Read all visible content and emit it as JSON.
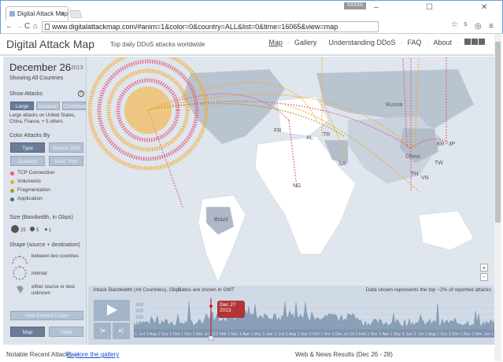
{
  "browser": {
    "tab_title": "Digital Attack Map",
    "user_badge": "XXXXX",
    "url": "www.digitalattackmap.com/#anim=1&color=0&country=ALL&list=0&time=16065&view=map"
  },
  "header": {
    "logo": "Digital Attack Map",
    "tagline": "Top daily DDoS attacks worldwide",
    "nav": [
      "Map",
      "Gallery",
      "Understanding DDoS",
      "FAQ",
      "About"
    ]
  },
  "sidebar": {
    "date": "December 26",
    "year": "2013",
    "showing": "Showing All Countries",
    "show_attacks_label": "Show Attacks",
    "attack_buttons": [
      "Large",
      "Unusual",
      "Combined"
    ],
    "attack_desc": "Large attacks on United States, China, France, + 5 others",
    "color_by_label": "Color Attacks By",
    "color_buttons": [
      "Type",
      "Source Port",
      "Duration",
      "Dest. Port"
    ],
    "legend": [
      {
        "label": "TCP Connection",
        "color": "#e0607e"
      },
      {
        "label": "Volumetric",
        "color": "#f3a92b"
      },
      {
        "label": "Fragmentation",
        "color": "#a6a021"
      },
      {
        "label": "Application",
        "color": "#3f6f8f"
      }
    ],
    "size_label": "Size (Bandwidth, in Gbps)",
    "sizes": [
      "25",
      "5",
      "1"
    ],
    "shape_label": "Shape (source + destination)",
    "shapes": [
      "between two countries",
      "internal",
      "either source or dest. unknown"
    ],
    "embed": "+Get Embed Code+",
    "view_buttons": [
      "Map",
      "Table"
    ]
  },
  "map": {
    "labels": [
      "Russia",
      "Brazil",
      "China",
      "KR",
      "JP",
      "TW",
      "TH",
      "VN",
      "SA",
      "NG",
      "AL",
      "FR",
      "TR"
    ],
    "zoom_in": "+",
    "zoom_out": "-"
  },
  "timeline": {
    "title": "Attack Bandwidth (All Countries), Gbps",
    "gmt": "Dates are shown in GMT",
    "note": "Data shown represents the top ~2% of reported attacks",
    "yticks": [
      "400",
      "300",
      "200",
      "100"
    ],
    "months": [
      "1 Jul",
      "1 Aug",
      "1 Sep",
      "1 Oct",
      "1 Nov",
      "1 Dec",
      "Jan 1, 2013",
      "1 Feb",
      "1 Mar",
      "1 Apr",
      "1 May",
      "1 Jun",
      "1 Jul",
      "1 Aug",
      "1 Sep",
      "1 Oct",
      "1 Nov",
      "1 Dec",
      "Jan 1, 2014",
      "1 Feb",
      "1 Mar",
      "1 Apr",
      "1 May",
      "1 Jun",
      "1 Jul",
      "1 Aug",
      "1 Sep",
      "1 Oct",
      "1 Nov",
      "1 Dec",
      "Jan 1"
    ],
    "tooltip_date": "Dec 27",
    "tooltip_year": "2013"
  },
  "footer": {
    "notable": "Notable Recent Attacks — ",
    "gallery_link": "Explore the gallery",
    "web_news": "Web & News Results (Dec 26 - 28)"
  }
}
